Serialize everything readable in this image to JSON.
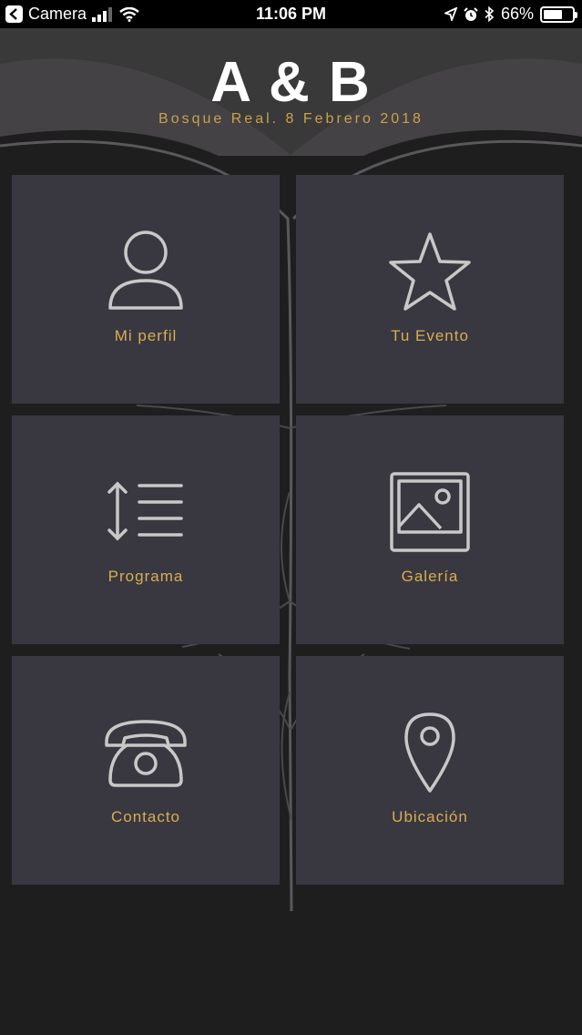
{
  "status_bar": {
    "back_app": "Camera",
    "time": "11:06 PM",
    "battery": "66%",
    "battery_level": 0.66
  },
  "header": {
    "title": "A & B",
    "subtitle": "Bosque Real. 8 Febrero 2018"
  },
  "tiles": [
    {
      "label": "Mi perfil",
      "icon": "person-icon"
    },
    {
      "label": "Tu Evento",
      "icon": "star-icon"
    },
    {
      "label": "Programa",
      "icon": "list-sort-icon"
    },
    {
      "label": "Galería",
      "icon": "picture-icon"
    },
    {
      "label": "Contacto",
      "icon": "telephone-icon"
    },
    {
      "label": "Ubicación",
      "icon": "location-pin-icon"
    }
  ],
  "colors": {
    "background": "#1f1e1f",
    "tile": "#393840",
    "accent": "#d8ad52",
    "icon_stroke": "#c8c8c8"
  }
}
